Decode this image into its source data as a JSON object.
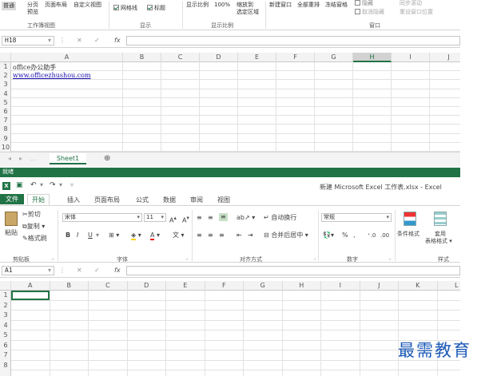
{
  "top": {
    "ribbon": {
      "normal": "普通",
      "page_break": "分页",
      "page_break2": "预览",
      "page_layout": "页面布局",
      "custom_view": "自定义视图",
      "gridlines": "网格线",
      "headings": "标题",
      "zoom": "显示比例",
      "zoom100": "100%",
      "zoom_sel1": "缩放到",
      "zoom_sel2": "选定区域",
      "new_window": "新建窗口",
      "arrange_all": "全部重排",
      "freeze": "冻结窗格",
      "hide": "隐藏",
      "unhide": "取消隐藏",
      "sync_scroll": "同步滚动",
      "reset_pos": "重设窗口位置",
      "groups": {
        "workbook_views": "工作簿视图",
        "show": "显示",
        "zoom": "显示比例",
        "window": "窗口"
      }
    },
    "namebox": "H18",
    "fx": "fx",
    "columns": [
      "A",
      "B",
      "C",
      "D",
      "E",
      "F",
      "G",
      "H",
      "I",
      "J"
    ],
    "rows": [
      "1",
      "2",
      "3",
      "4",
      "5",
      "6",
      "7",
      "8",
      "9",
      "10"
    ],
    "a1": "office办公助手",
    "a2": "www.officezhushou.com",
    "sheet_tab": "Sheet1",
    "add_sheet": "⊕",
    "status": "就绪"
  },
  "bottom": {
    "title": "新建 Microsoft Excel 工作表.xlsx - Excel",
    "tabs": [
      "文件",
      "开始",
      "插入",
      "页面布局",
      "公式",
      "数据",
      "审阅",
      "视图"
    ],
    "ribbon": {
      "paste": "粘贴",
      "cut": "剪切",
      "copy": "复制",
      "format_painter": "格式刷",
      "font_name": "宋体",
      "font_size": "11",
      "bold": "B",
      "italic": "I",
      "underline": "U",
      "wrap": "自动换行",
      "merge": "合并后居中",
      "number_format": "常规",
      "percent": "%",
      "comma": ",",
      "cond_format": "条件格式",
      "table_format1": "套用",
      "table_format2": "表格格式",
      "groups": {
        "clipboard": "剪贴板",
        "font": "字体",
        "alignment": "对齐方式",
        "number": "数字",
        "styles": "样式"
      }
    },
    "namebox": "A1",
    "fx": "fx",
    "columns": [
      "A",
      "B",
      "C",
      "D",
      "E",
      "F",
      "G",
      "H",
      "I",
      "J",
      "K",
      "L"
    ],
    "rows": [
      "1",
      "2",
      "3",
      "4",
      "5",
      "6",
      "7",
      "8"
    ]
  },
  "watermark": "最需教育",
  "colors": {
    "accent": "#217346",
    "link": "#1a0dab",
    "watermark": "#1e5bb8"
  }
}
